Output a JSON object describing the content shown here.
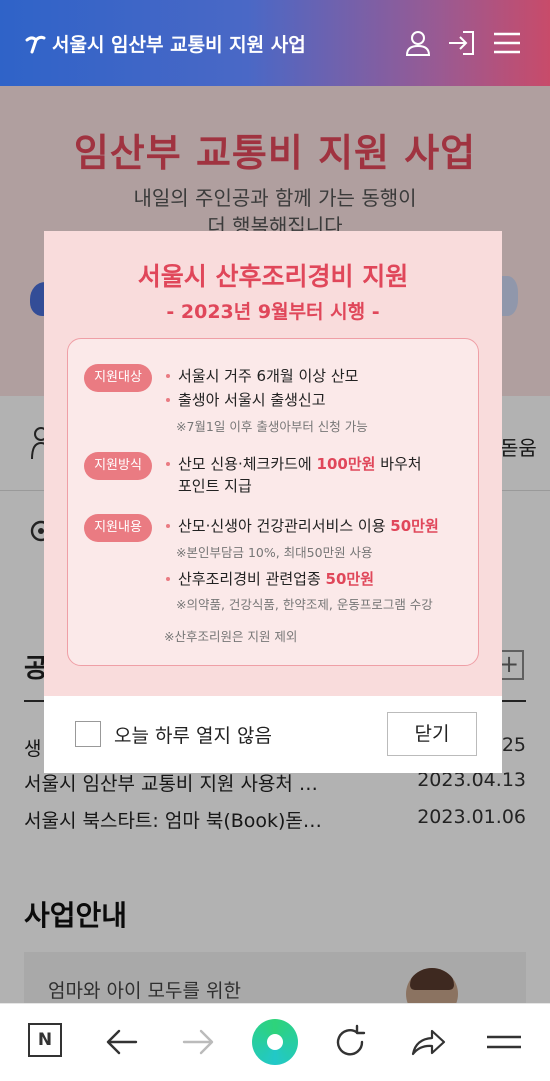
{
  "header": {
    "title": "서울시 임산부 교통비 지원 사업",
    "icons": [
      "user-icon",
      "login-icon",
      "menu-icon"
    ]
  },
  "hero": {
    "title": "임산부 교통비 지원 사업",
    "subtitle_line1": "내일의 주인공과 함께 가는 동행이",
    "subtitle_line2": "더 행복해집니다"
  },
  "menu": {
    "right_label": "돋움"
  },
  "notices": {
    "heading": "공",
    "items": [
      {
        "title": "생",
        "date": "25"
      },
      {
        "title": "서울시 임산부 교통비 지원 사용처 …",
        "date": "2023.04.13"
      },
      {
        "title": "서울시 북스타트: 엄마 북(Book)돋…",
        "date": "2023.01.06"
      }
    ]
  },
  "business": {
    "heading": "사업안내",
    "card_text": "엄마와 아이 모두를 위한"
  },
  "popup": {
    "title": "서울시 산후조리경비 지원",
    "subtitle": "- 2023년 9월부터 시행 -",
    "sections": [
      {
        "tag": "지원대상",
        "lines": [
          "서울시 거주 6개월 이상 산모",
          "출생아 서울시 출생신고"
        ],
        "note": "※7월1일 이후 출생아부터 신청 가능"
      },
      {
        "tag": "지원방식",
        "line1_pre": "산모 신용·체크카드에 ",
        "line1_hl": "100만원",
        "line1_post": " 바우처",
        "line2": "포인트 지급"
      },
      {
        "tag": "지원내용",
        "item1_pre": "산모·신생아 건강관리서비스 이용 ",
        "item1_hl": "50만원",
        "item1_note": "※본인부담금 10%, 최대50만원 사용",
        "item2_pre": "산후조리경비 관련업종 ",
        "item2_hl": "50만원",
        "item2_note": "※의약품, 건강식품, 한약조제, 운동프로그램 수강"
      }
    ],
    "footnote": "※산후조리원은 지원 제외",
    "dont_show_label": "오늘 하루 열지 않음",
    "close_label": "닫기"
  },
  "browser_bar": {
    "n_label": "N",
    "icons": [
      "naver-n-icon",
      "back-arrow-icon",
      "forward-arrow-icon",
      "green-dot-icon",
      "reload-icon",
      "share-icon",
      "menu-icon"
    ]
  },
  "colors": {
    "accent": "#e0475a",
    "pill": "#ea7b82",
    "popup_bg": "#f9dcdc",
    "header_start": "#2f63c8",
    "header_end": "#c84b6a"
  }
}
